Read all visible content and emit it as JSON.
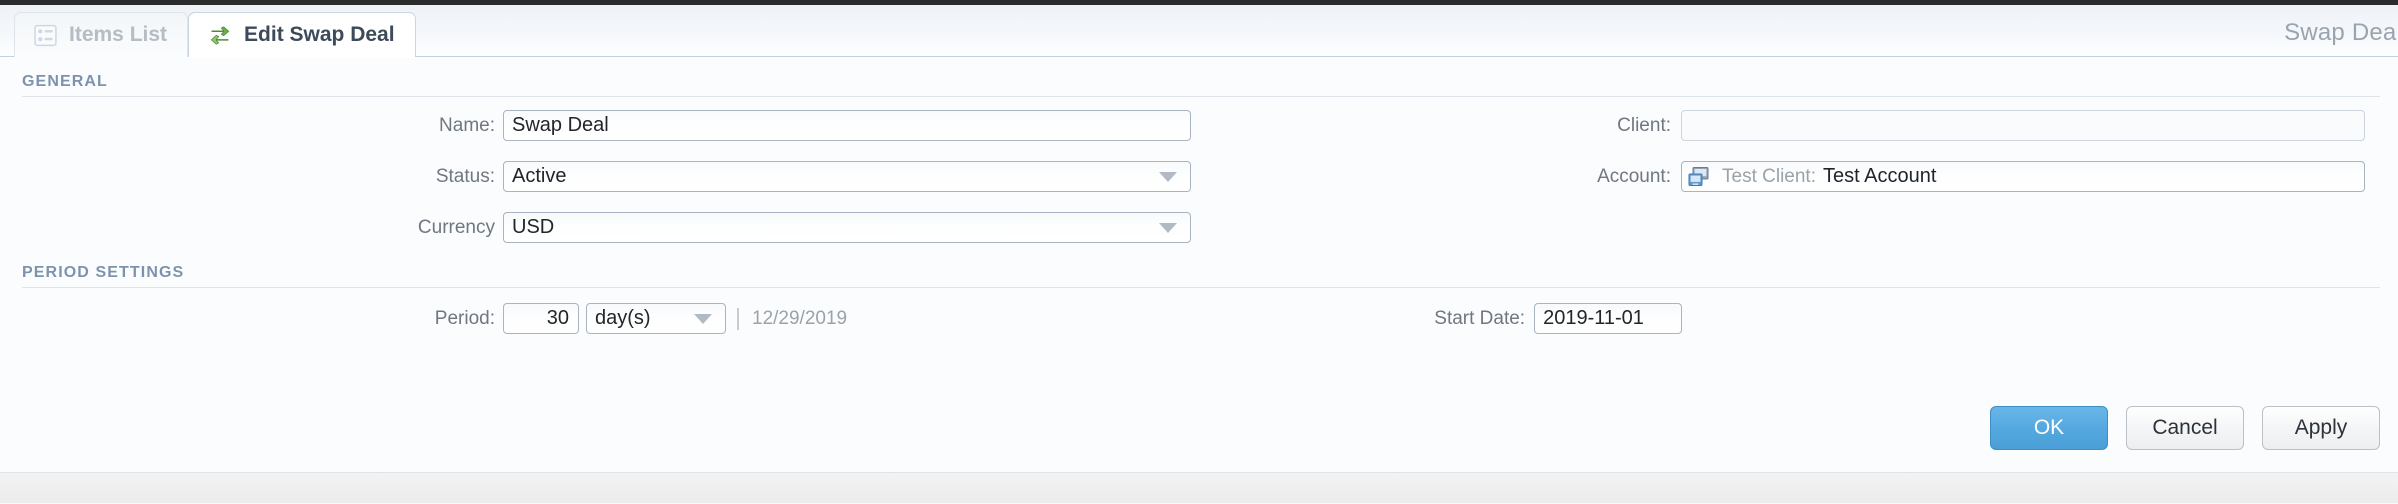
{
  "window": {
    "tabs": [
      {
        "label": "Items List",
        "icon": "list-icon",
        "active": false
      },
      {
        "label": "Edit Swap Deal",
        "icon": "swap-arrows-icon",
        "active": true
      }
    ],
    "corner_title": "Swap Deal"
  },
  "sections": {
    "general": {
      "title": "GENERAL",
      "fields": {
        "name": {
          "label": "Name:",
          "value": "Swap Deal"
        },
        "status": {
          "label": "Status:",
          "value": "Active",
          "type": "select"
        },
        "currency": {
          "label": "Currency",
          "value": "USD",
          "type": "select"
        },
        "client": {
          "label": "Client:",
          "value": "",
          "placeholder": ""
        },
        "account": {
          "label": "Account:",
          "icon": "account-monitor-icon",
          "prefix": "Test Client:",
          "value": "Test Account"
        }
      }
    },
    "period_settings": {
      "title": "PERIOD SETTINGS",
      "fields": {
        "period": {
          "label": "Period:",
          "value": "30",
          "unit": "day(s)",
          "separator": "|",
          "end_date": "12/29/2019"
        },
        "start_date": {
          "label": "Start Date:",
          "value": "2019-11-01"
        }
      }
    }
  },
  "buttons": {
    "ok": "OK",
    "cancel": "Cancel",
    "apply": "Apply"
  },
  "colors": {
    "accent": "#4a9fd8",
    "section_heading": "#7d93ad",
    "tab_active_text": "#3d4a5a",
    "tab_inactive_text": "#b6bcc4",
    "swap_icon_green": "#63b254"
  }
}
